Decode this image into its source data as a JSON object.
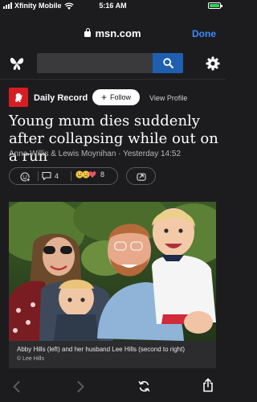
{
  "status": {
    "carrier": "Xfinity Mobile",
    "time": "5:16 AM"
  },
  "browser": {
    "domain": "msn.com",
    "done_label": "Done"
  },
  "header": {
    "search_placeholder": ""
  },
  "publisher": {
    "name": "Daily Record",
    "follow_label": "Follow",
    "view_profile_label": "View Profile"
  },
  "article": {
    "headline": "Young mum dies suddenly after collapsing while out on a run",
    "byline": "Anna Willis & Lewis Moynihan · Yesterday 14:52",
    "comments_count": "4",
    "reactions_count": "8",
    "caption": "Abby Hills (left) and her husband Lee Hills (second to right)",
    "credit": "© Lee Hills"
  },
  "colors": {
    "accent": "#1f5fb0",
    "link": "#3d8bfd",
    "publisher": "#d71d24",
    "background": "#1c1c1e"
  },
  "icons": [
    "lock-icon",
    "msn-butterfly-icon",
    "search-icon",
    "gear-icon",
    "add-reaction-icon",
    "comment-icon",
    "share-icon",
    "back-icon",
    "forward-icon",
    "reload-icon",
    "share-sheet-icon"
  ]
}
